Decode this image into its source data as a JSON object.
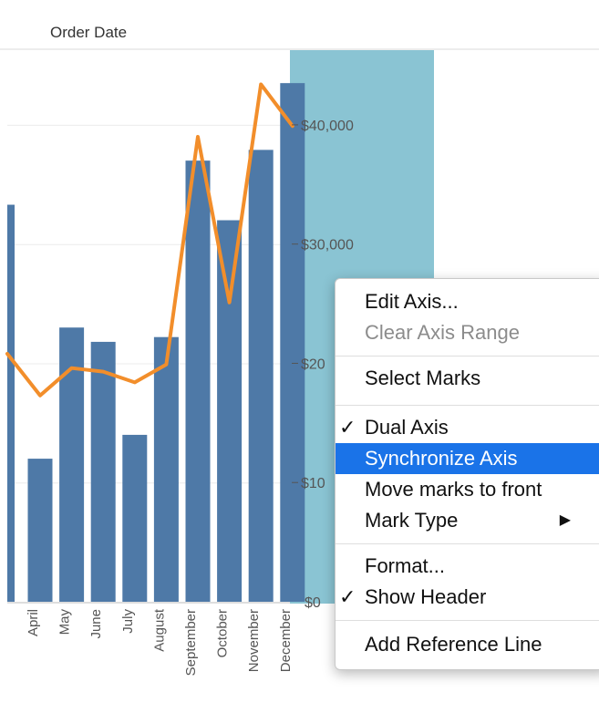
{
  "header": {
    "title": "Order Date"
  },
  "chart_data": {
    "type": "bar",
    "categories": [
      "April",
      "May",
      "June",
      "July",
      "August",
      "September",
      "October",
      "November",
      "December"
    ],
    "series": [
      {
        "type": "bar",
        "values": [
          12000,
          23000,
          21800,
          14000,
          22200,
          37000,
          32000,
          37900,
          43500
        ]
      },
      {
        "type": "line",
        "values": [
          17300,
          19600,
          19300,
          18400,
          19900,
          39000,
          25100,
          43400,
          39900
        ]
      }
    ],
    "partial_left_values": {
      "bar": 33300,
      "line": 20800
    },
    "yaxis_ticks": [
      "$0",
      "$10",
      "$20",
      "$30,000",
      "$40,000"
    ],
    "ylim": [
      0,
      45500
    ],
    "colors": {
      "bars": "#4e79a7",
      "line": "#f28e2b",
      "axis_highlight": "#8ac4d3"
    }
  },
  "context_menu": {
    "items": [
      {
        "label": "Edit Axis...",
        "enabled": true,
        "checked": false
      },
      {
        "label": "Clear Axis Range",
        "enabled": false,
        "checked": false
      },
      {
        "label": "Select Marks",
        "enabled": true,
        "checked": false
      },
      {
        "label": "Dual Axis",
        "enabled": true,
        "checked": true
      },
      {
        "label": "Synchronize Axis",
        "enabled": true,
        "checked": false,
        "highlighted": true
      },
      {
        "label": "Move marks to front",
        "enabled": true,
        "checked": false
      },
      {
        "label": "Mark Type",
        "enabled": true,
        "checked": false,
        "submenu": true
      },
      {
        "label": "Format...",
        "enabled": true,
        "checked": false
      },
      {
        "label": "Show Header",
        "enabled": true,
        "checked": true
      },
      {
        "label": "Add Reference Line",
        "enabled": true,
        "checked": false
      }
    ],
    "check_glyph": "✓",
    "submenu_glyph": "▶"
  }
}
